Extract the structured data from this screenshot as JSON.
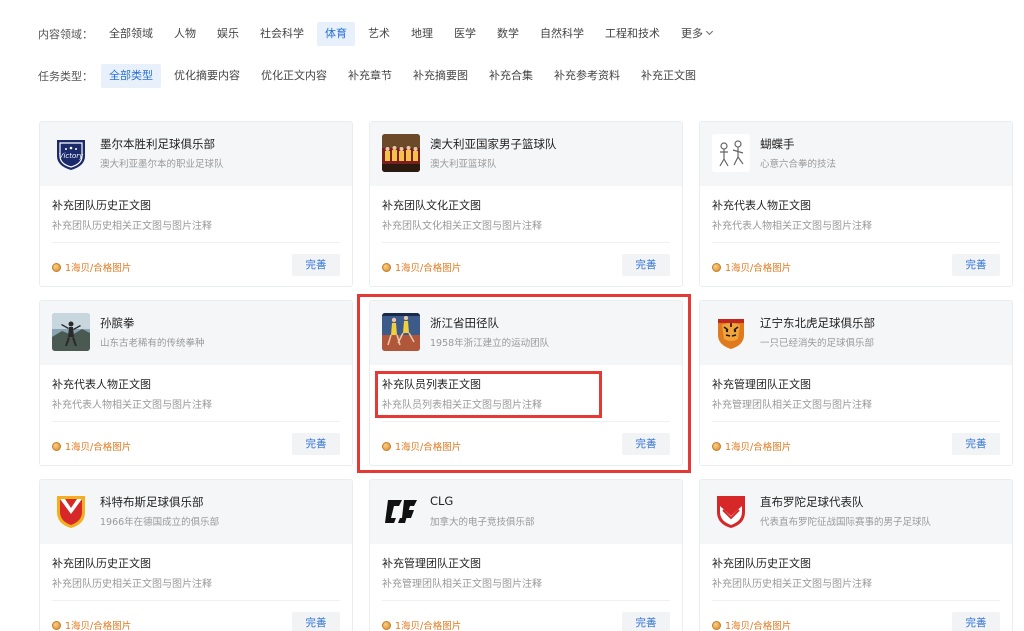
{
  "filters": {
    "domain": {
      "label": "内容领域：",
      "tags": [
        "全部领域",
        "人物",
        "娱乐",
        "社会科学",
        "体育",
        "艺术",
        "地理",
        "医学",
        "数学",
        "自然科学",
        "工程和技术",
        "更多"
      ],
      "active": "体育"
    },
    "task_type": {
      "label": "任务类型：",
      "tags": [
        "全部类型",
        "优化摘要内容",
        "优化正文内容",
        "补充章节",
        "补充摘要图",
        "补充合集",
        "补充参考资料",
        "补充正文图"
      ],
      "active": "全部类型"
    }
  },
  "cards": [
    {
      "logo": "victory-badge-icon",
      "title": "墨尔本胜利足球俱乐部",
      "subtitle": "澳大利亚墨尔本的职业足球队",
      "task_title": "补充团队历史正文图",
      "task_desc": "补充团队历史相关正文图与图片注释",
      "reward": "1海贝/合格图片",
      "button": "完善"
    },
    {
      "logo": "basketball-team-photo-icon",
      "title": "澳大利亚国家男子篮球队",
      "subtitle": "澳大利亚篮球队",
      "task_title": "补充团队文化正文图",
      "task_desc": "补充团队文化相关正文图与图片注释",
      "reward": "1海贝/合格图片",
      "button": "完善"
    },
    {
      "logo": "butterfly-fist-icon",
      "title": "蝴蝶手",
      "subtitle": "心意六合拳的技法",
      "task_title": "补充代表人物正文图",
      "task_desc": "补充代表人物相关正文图与图片注释",
      "reward": "1海贝/合格图片",
      "button": "完善"
    },
    {
      "logo": "martial-artist-photo-icon",
      "title": "孙膑拳",
      "subtitle": "山东古老稀有的传统拳种",
      "task_title": "补充代表人物正文图",
      "task_desc": "补充代表人物相关正文图与图片注释",
      "reward": "1海贝/合格图片",
      "button": "完善"
    },
    {
      "logo": "track-athletes-photo-icon",
      "title": "浙江省田径队",
      "subtitle": "1958年浙江建立的运动团队",
      "task_title": "补充队员列表正文图",
      "task_desc": "补充队员列表相关正文图与图片注释",
      "reward": "1海贝/合格图片",
      "button": "完善"
    },
    {
      "logo": "tiger-badge-icon",
      "title": "辽宁东北虎足球俱乐部",
      "subtitle": "一只已经消失的足球俱乐部",
      "task_title": "补充管理团队正文图",
      "task_desc": "补充管理团队相关正文图与图片注释",
      "reward": "1海贝/合格图片",
      "button": "完善"
    },
    {
      "logo": "kortrijk-shield-icon",
      "title": "科特布斯足球俱乐部",
      "subtitle": "1966年在德国成立的俱乐部",
      "task_title": "补充团队历史正文图",
      "task_desc": "补充团队历史相关正文图与图片注释",
      "reward": "1海贝/合格图片",
      "button": "完善"
    },
    {
      "logo": "clg-logo-icon",
      "title": "CLG",
      "subtitle": "加拿大的电子竞技俱乐部",
      "task_title": "补充管理团队正文图",
      "task_desc": "补充管理团队相关正文图与图片注释",
      "reward": "1海贝/合格图片",
      "button": "完善"
    },
    {
      "logo": "gibraltar-shield-icon",
      "title": "直布罗陀足球代表队",
      "subtitle": "代表直布罗陀征战国际赛事的男子足球队",
      "task_title": "补充团队历史正文图",
      "task_desc": "补充团队历史相关正文图与图片注释",
      "reward": "1海贝/合格图片",
      "button": "完善"
    }
  ],
  "colors": {
    "accent": "#2a6fd6",
    "active_tag_bg": "#e8f1fb",
    "reward": "#e07a1f",
    "highlight": "#e53935",
    "card_head_bg": "#f5f6f8"
  }
}
